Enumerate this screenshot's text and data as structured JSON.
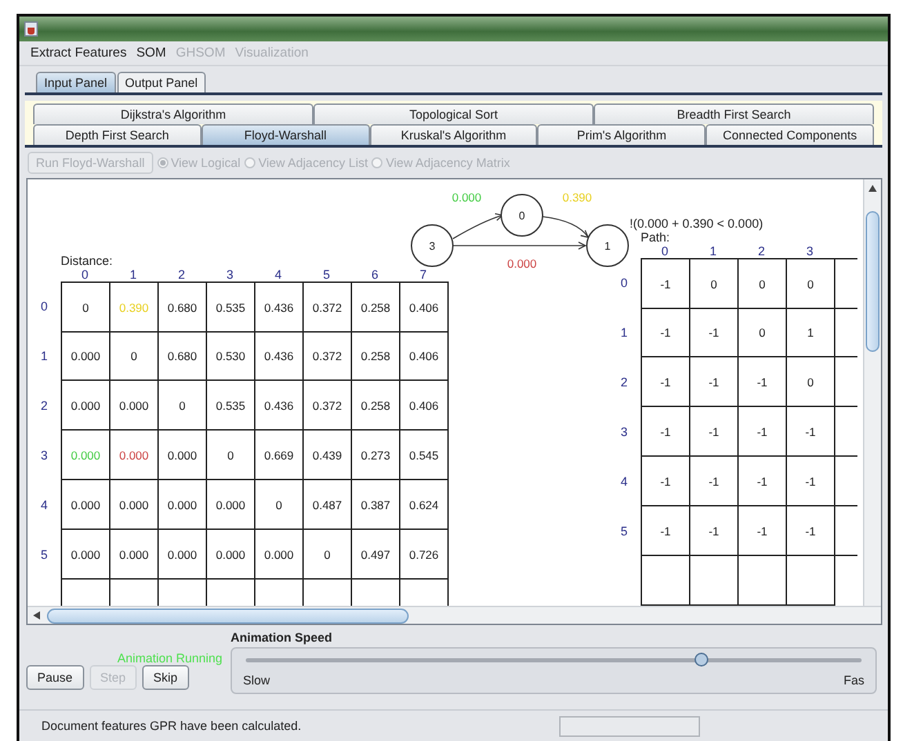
{
  "menu": [
    {
      "label": "Extract Features",
      "disabled": false
    },
    {
      "label": "SOM",
      "disabled": false
    },
    {
      "label": "GHSOM",
      "disabled": true
    },
    {
      "label": "Visualization",
      "disabled": true
    }
  ],
  "panel_tabs": [
    {
      "label": "Input Panel",
      "selected": true
    },
    {
      "label": "Output Panel",
      "selected": false
    }
  ],
  "algorithm_tabs": [
    [
      {
        "label": "Dijkstra's Algorithm",
        "selected": false
      },
      {
        "label": "Topological Sort",
        "selected": false
      },
      {
        "label": "Breadth First Search",
        "selected": false
      }
    ],
    [
      {
        "label": "Depth First Search",
        "selected": false
      },
      {
        "label": "Floyd-Warshall",
        "selected": true
      },
      {
        "label": "Kruskal's Algorithm",
        "selected": false
      },
      {
        "label": "Prim's Algorithm",
        "selected": false
      },
      {
        "label": "Connected Components",
        "selected": false
      }
    ]
  ],
  "toolbar": {
    "run_button": {
      "label": "Run Floyd-Warshall",
      "disabled": true
    },
    "views": [
      {
        "label": "View Logical",
        "selected": true
      },
      {
        "label": "View Adjacency List",
        "selected": false
      },
      {
        "label": "View Adjacency Matrix",
        "selected": false
      }
    ]
  },
  "graph": {
    "nodes": [
      {
        "label": "3"
      },
      {
        "label": "0"
      },
      {
        "label": "1"
      }
    ],
    "edges": [
      {
        "label": "0.000",
        "color": "#44cc44"
      },
      {
        "label": "0.390",
        "color": "#e8d020"
      },
      {
        "label": "0.000",
        "color": "#cc4444"
      }
    ],
    "condition": "!(0.000 + 0.390 < 0.000)"
  },
  "distance": {
    "title": "Distance:",
    "columns": [
      "0",
      "1",
      "2",
      "3",
      "4",
      "5",
      "6",
      "7"
    ],
    "rows": [
      {
        "label": "0",
        "cells": [
          "0",
          {
            "text": "0.390",
            "color": "#e8d020"
          },
          "0.680",
          "0.535",
          "0.436",
          "0.372",
          "0.258",
          "0.406"
        ]
      },
      {
        "label": "1",
        "cells": [
          "0.000",
          "0",
          "0.680",
          "0.530",
          "0.436",
          "0.372",
          "0.258",
          "0.406"
        ]
      },
      {
        "label": "2",
        "cells": [
          "0.000",
          "0.000",
          "0",
          "0.535",
          "0.436",
          "0.372",
          "0.258",
          "0.406"
        ]
      },
      {
        "label": "3",
        "cells": [
          {
            "text": "0.000",
            "color": "#44cc44"
          },
          {
            "text": "0.000",
            "color": "#cc4444"
          },
          "0.000",
          "0",
          "0.669",
          "0.439",
          "0.273",
          "0.545"
        ]
      },
      {
        "label": "4",
        "cells": [
          "0.000",
          "0.000",
          "0.000",
          "0.000",
          "0",
          "0.487",
          "0.387",
          "0.624"
        ]
      },
      {
        "label": "5",
        "cells": [
          "0.000",
          "0.000",
          "0.000",
          "0.000",
          "0.000",
          "0",
          "0.497",
          "0.726"
        ]
      }
    ]
  },
  "path": {
    "title": "Path:",
    "columns": [
      "0",
      "1",
      "2",
      "3"
    ],
    "rows": [
      {
        "label": "0",
        "cells": [
          "-1",
          "0",
          "0",
          "0"
        ]
      },
      {
        "label": "1",
        "cells": [
          "-1",
          "-1",
          "0",
          "1"
        ]
      },
      {
        "label": "2",
        "cells": [
          "-1",
          "-1",
          "-1",
          "0"
        ]
      },
      {
        "label": "3",
        "cells": [
          "-1",
          "-1",
          "-1",
          "-1"
        ]
      },
      {
        "label": "4",
        "cells": [
          "-1",
          "-1",
          "-1",
          "-1"
        ]
      },
      {
        "label": "5",
        "cells": [
          "-1",
          "-1",
          "-1",
          "-1"
        ]
      }
    ]
  },
  "animation": {
    "status": "Animation Running",
    "buttons": [
      {
        "label": "Pause",
        "disabled": false
      },
      {
        "label": "Step",
        "disabled": true
      },
      {
        "label": "Skip",
        "disabled": false
      }
    ],
    "speed": {
      "title": "Animation Speed",
      "level": 0.74,
      "min_label": "Slow",
      "max_label": "Fas"
    }
  },
  "status_bar": {
    "message": "Document features GPR have been calculated.",
    "progress": {
      "level": 0
    }
  }
}
